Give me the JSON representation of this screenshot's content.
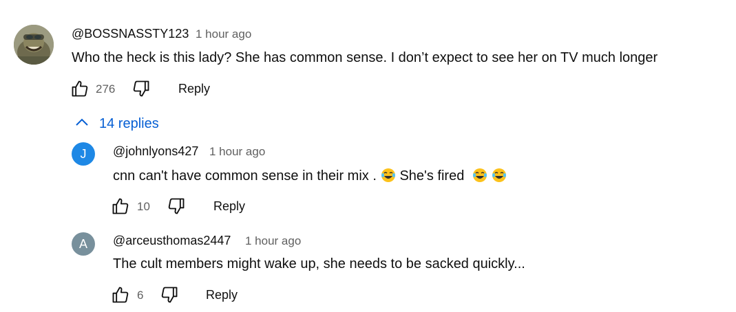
{
  "comment": {
    "author": "@BOSSNASSTY123",
    "time": "1 hour ago",
    "text": "Who the heck is this lady? She has common sense. I don’t expect to see her on TV much longer",
    "likes": "276",
    "reply_label": "Reply"
  },
  "replies_toggle": {
    "label": "14 replies",
    "icon": "chevron-up-icon"
  },
  "replies": [
    {
      "avatar_letter": "J",
      "avatar_color": "#1e88e5",
      "author": "@johnlyons427",
      "time": "1 hour ago",
      "text_part1": "cnn can't have common sense in their mix .",
      "text_part2": " She's fired ",
      "emoji": "face-with-tears-of-joy",
      "likes": "10",
      "reply_label": "Reply"
    },
    {
      "avatar_letter": "A",
      "avatar_color": "#78909c",
      "author": "@arceusthomas2447",
      "time": "1 hour ago",
      "text": "The cult members might wake up, she needs to be sacked quickly...",
      "likes": "6",
      "reply_label": "Reply"
    }
  ]
}
